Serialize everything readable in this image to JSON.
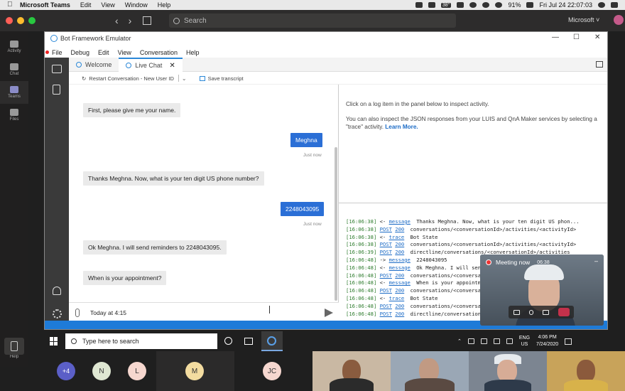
{
  "mac_menubar": {
    "app_name": "Microsoft Teams",
    "menu": [
      "Edit",
      "View",
      "Window",
      "Help"
    ],
    "temperature": "38°",
    "battery": "91%",
    "datetime": "Fri Jul 24  22:07:03"
  },
  "teams": {
    "search_placeholder": "Search",
    "tenant": "Microsoft ˅",
    "rail": [
      {
        "label": "Activity"
      },
      {
        "label": "Chat"
      },
      {
        "label": "Teams"
      },
      {
        "label": "Files"
      },
      {
        "label": "Help"
      }
    ]
  },
  "emulator": {
    "title": "Bot Framework Emulator",
    "menu": [
      "File",
      "Debug",
      "Edit",
      "View",
      "Conversation",
      "Help"
    ],
    "tabs": [
      {
        "label": "Welcome"
      },
      {
        "label": "Live Chat",
        "close": "✕"
      }
    ],
    "toolbar": {
      "restart_label": "Restart Conversation - New User ID",
      "save_label": "Save transcript"
    },
    "messages": [
      {
        "from": "bot",
        "text": "First, please give me your name."
      },
      {
        "from": "user",
        "text": "Meghna",
        "time": "Just now"
      },
      {
        "from": "bot",
        "text": "Thanks Meghna. Now, what is your ten digit US phone number?"
      },
      {
        "from": "user",
        "text": "2248043095",
        "time": "Just now"
      },
      {
        "from": "bot",
        "text": "Ok Meghna. I will send reminders to 2248043095."
      },
      {
        "from": "bot",
        "text": "When is your appointment?"
      }
    ],
    "input_value": "Today at 4:15",
    "inspector": {
      "line1": "Click on a log item in the panel below to inspect activity.",
      "line2": "You can also inspect the JSON responses from your LUIS and QnA Maker services by selecting a \"trace\" activity.",
      "learn_more": "Learn More."
    },
    "log": [
      {
        "ts": "[16:06:38]",
        "dir": "<-",
        "link": "message",
        "code": "",
        "text": "Thanks Meghna. Now, what is your ten digit US phon..."
      },
      {
        "ts": "[16:06:38]",
        "dir": "",
        "link": "POST",
        "code": "200",
        "text": "conversations/<conversationId>/activities/<activityId>"
      },
      {
        "ts": "[16:06:38]",
        "dir": "<-",
        "link": "trace",
        "code": "",
        "text": "Bot State"
      },
      {
        "ts": "[16:06:38]",
        "dir": "",
        "link": "POST",
        "code": "200",
        "text": "conversations/<conversationId>/activities/<activityId>"
      },
      {
        "ts": "[16:06:39]",
        "dir": "",
        "link": "POST",
        "code": "200",
        "text": "directline/conversations/<conversationId>/activities"
      },
      {
        "ts": "[16:06:48]",
        "dir": "->",
        "link": "message",
        "code": "",
        "text": "2248043095"
      },
      {
        "ts": "[16:06:48]",
        "dir": "<-",
        "link": "message",
        "code": "",
        "text": "Ok Meghna. I will send reminders to 2248043095."
      },
      {
        "ts": "[16:06:48]",
        "dir": "",
        "link": "POST",
        "code": "200",
        "text": "conversations/<conversationId>/activities/<activityId>"
      },
      {
        "ts": "[16:06:48]",
        "dir": "<-",
        "link": "message",
        "code": "",
        "text": "When is your appointment?"
      },
      {
        "ts": "[16:06:48]",
        "dir": "",
        "link": "POST",
        "code": "200",
        "text": "conversations/<conversationId>/activities/<activityId>"
      },
      {
        "ts": "[16:06:48]",
        "dir": "<-",
        "link": "trace",
        "code": "",
        "text": "Bot State"
      },
      {
        "ts": "[16:06:48]",
        "dir": "",
        "link": "POST",
        "code": "200",
        "text": "conversations/<conversationId>/activities/<activityId>"
      },
      {
        "ts": "[16:06:48]",
        "dir": "",
        "link": "POST",
        "code": "200",
        "text": "directline/conversations/<conversationId>/activities"
      }
    ]
  },
  "meeting": {
    "label": "Meeting now",
    "duration": "06:38",
    "minimize": "–"
  },
  "windows_taskbar": {
    "search_placeholder": "Type here to search",
    "lang": "ENG",
    "region": "US",
    "time": "4:06 PM",
    "date": "7/24/2020"
  },
  "gallery": {
    "overflow_count": "+4",
    "avatars": [
      {
        "initials": "N",
        "color": "#dfe7d2"
      },
      {
        "initials": "L",
        "color": "#f6d7cf"
      },
      {
        "initials": "M",
        "color": "#f3dca0"
      },
      {
        "initials": "JC",
        "color": "#f6d7cf"
      }
    ]
  },
  "colors": {
    "accent": "#2b6fd6",
    "status_bar": "#1e7bd8",
    "teams_purple": "#5b5fc7",
    "hangup": "#c4314b"
  }
}
